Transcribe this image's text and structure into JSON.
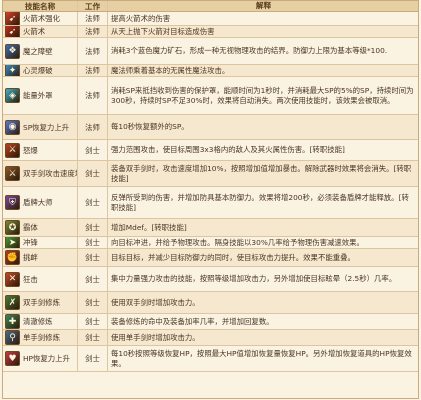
{
  "header": {
    "skill": "技能名称",
    "job": "工作",
    "desc": "解释"
  },
  "rows": [
    {
      "icon": "fire-arrow-icon",
      "name": "火箭术强化",
      "job": "法师",
      "desc": "提高火箭术的伤害",
      "color": "#d8412a"
    },
    {
      "icon": "fire-arrow-icon",
      "name": "火箭术",
      "job": "法师",
      "desc": "从天上抛下火箭对目标造成伤害",
      "color": "#c7301f"
    },
    {
      "icon": "crystal-icon",
      "name": "魔之障壁",
      "job": "法师",
      "desc": "消耗3个蓝色魔力矿石，形成一种无视物理攻击的结界。防御力上限为基本等级*100.",
      "color": "#3f6fb5"
    },
    {
      "icon": "ice-lightning-icon",
      "name": "心灵爆破",
      "job": "法师",
      "desc": "魔法师乘着基本的无属性魔法攻击。",
      "color": "#3a8fc8"
    },
    {
      "icon": "shield-icon",
      "name": "能量外罩",
      "job": "法师",
      "desc": "消耗SP来抵挡收到伤害的保护罩，能顺时间为1秒时，并消耗最大SP的5%的SP，持续时间为300秒，持续时SP不足30%时，效果将自动消失。两次使用技能时，该效果会被取消。",
      "color": "#3fb4c9"
    },
    {
      "icon": "mana-orb-icon",
      "name": "SP恢复力上升",
      "job": "法师",
      "desc": "每10秒恢复额外的SP。",
      "color": "#5a7ad8"
    },
    {
      "icon": "sword-fire-icon",
      "name": "怒爆",
      "job": "剑士",
      "desc": "强力范围攻击，使目标周围3x3格内的敌人及其火属性伤害。[转职技能]",
      "color": "#b8421f"
    },
    {
      "icon": "twin-swords-icon",
      "name": "双手剑攻击速度增加",
      "job": "剑士",
      "desc": "装备双手剑时，攻击速度增加10%，按照增加值增加暴击。解除武器时效果将会消失。[转职技能]",
      "color": "#8a5a2a"
    },
    {
      "icon": "purple-shield-icon",
      "name": "盾牌大师",
      "job": "剑士",
      "desc": "反弹所受到的伤害，并增加防具基本防御力。效果将增200秒，必须装备盾牌才能释放。[转职技能]",
      "color": "#7a4a9a"
    },
    {
      "icon": "body-icon",
      "name": "霸体",
      "job": "剑士",
      "desc": "增加Mdef。[转职技能]",
      "color": "#7a8a3a"
    },
    {
      "icon": "dash-icon",
      "name": "冲锋",
      "job": "剑士",
      "desc": "向目标冲进，并给予物理攻击。隔身技能以30%几率给予物理伤害减速效果。",
      "color": "#4a9a3a"
    },
    {
      "icon": "provoke-icon",
      "name": "挑衅",
      "job": "剑士",
      "desc": "目标目标，并减少目标防御力的同时，使目标攻击力提升。效果不能重叠。",
      "color": "#b83a2a"
    },
    {
      "icon": "crossed-swords-icon",
      "name": "狂击",
      "job": "剑士",
      "desc": "集中力量强力攻击的技能，按照等级增加攻击力，另外增加使目标眩晕（2.5秒）几率。",
      "color": "#c84a2a"
    },
    {
      "icon": "sword-mastery-icon",
      "name": "双手剑修炼",
      "job": "剑士",
      "desc": "使用双手剑时增加攻击力。",
      "color": "#4a7a3a"
    },
    {
      "icon": "hp-regen-icon",
      "name": "清澈修炼",
      "job": "剑士",
      "desc": "装备修炼的命中及装备加率几率，并增加回复数。",
      "color": "#3a8a5a"
    },
    {
      "icon": "single-sword-icon",
      "name": "单手剑修炼",
      "job": "剑士",
      "desc": "使用单手剑时增加攻击力。",
      "color": "#4a6a8a"
    },
    {
      "icon": "heart-icon",
      "name": "HP恢复力上升",
      "job": "剑士",
      "desc": "每10秒按照等级恢复HP，按照最大HP值增加恢复量恢复HP。另外增加恢复道具的HP恢复效果。",
      "color": "#c83a4a"
    }
  ]
}
